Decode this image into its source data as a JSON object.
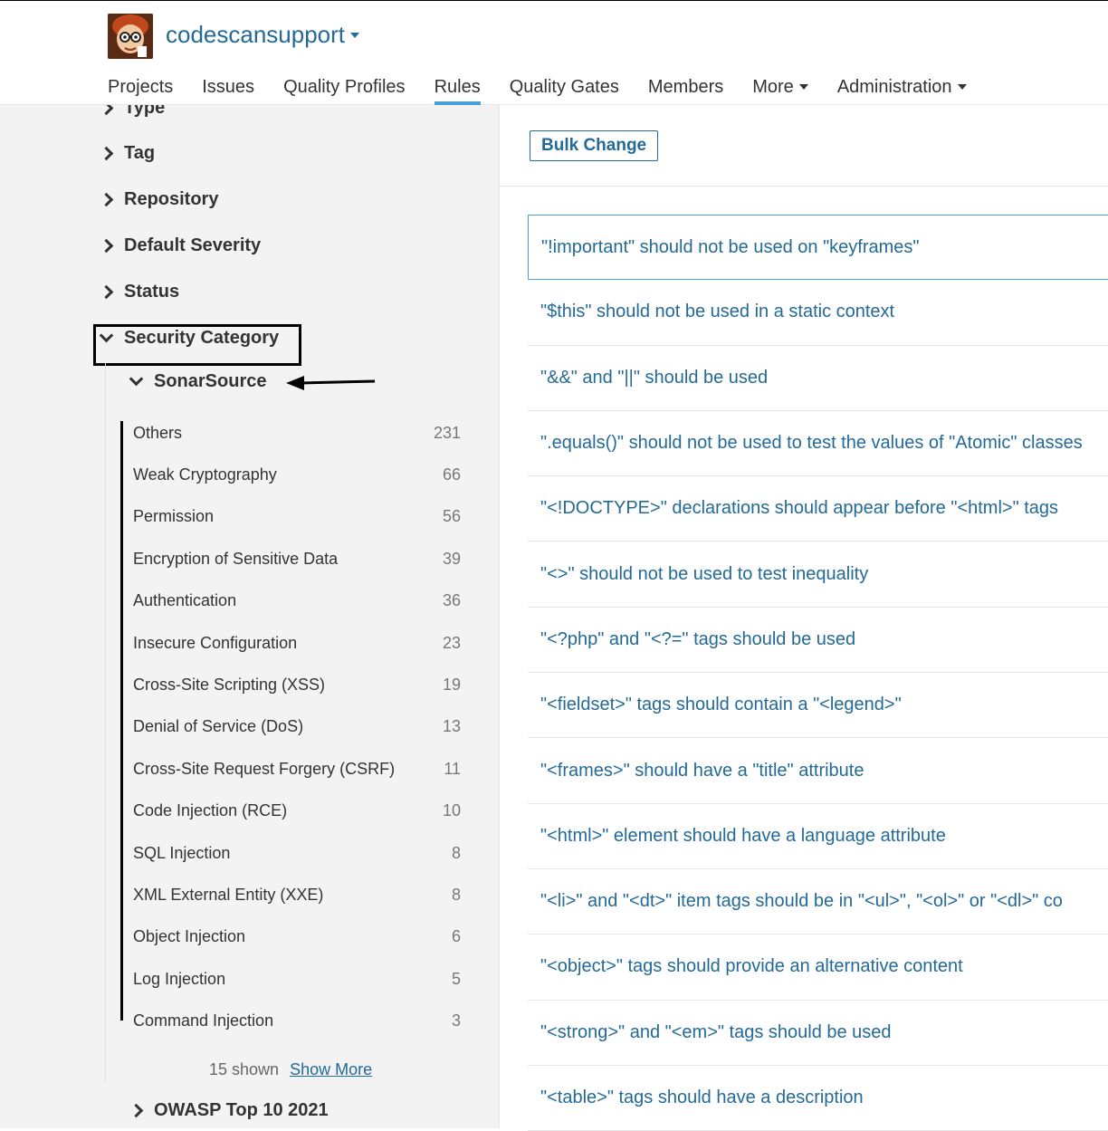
{
  "header": {
    "org_name": "codescansupport",
    "nav": [
      {
        "label": "Projects"
      },
      {
        "label": "Issues"
      },
      {
        "label": "Quality Profiles"
      },
      {
        "label": "Rules",
        "active": true
      },
      {
        "label": "Quality Gates"
      },
      {
        "label": "Members"
      },
      {
        "label": "More",
        "dropdown": true
      },
      {
        "label": "Administration",
        "dropdown": true
      }
    ]
  },
  "sidebar": {
    "facets": {
      "type": "Type",
      "tag": "Tag",
      "repository": "Repository",
      "severity": "Default Severity",
      "status": "Status",
      "security_category": "Security Category",
      "sonarsource": "SonarSource",
      "owasp": "OWASP Top 10 2021"
    },
    "categories": [
      {
        "name": "Others",
        "count": "231"
      },
      {
        "name": "Weak Cryptography",
        "count": "66"
      },
      {
        "name": "Permission",
        "count": "56"
      },
      {
        "name": "Encryption of Sensitive Data",
        "count": "39"
      },
      {
        "name": "Authentication",
        "count": "36"
      },
      {
        "name": "Insecure Configuration",
        "count": "23"
      },
      {
        "name": "Cross-Site Scripting (XSS)",
        "count": "19"
      },
      {
        "name": "Denial of Service (DoS)",
        "count": "13"
      },
      {
        "name": "Cross-Site Request Forgery (CSRF)",
        "count": "11"
      },
      {
        "name": "Code Injection (RCE)",
        "count": "10"
      },
      {
        "name": "SQL Injection",
        "count": "8"
      },
      {
        "name": "XML External Entity (XXE)",
        "count": "8"
      },
      {
        "name": "Object Injection",
        "count": "6"
      },
      {
        "name": "Log Injection",
        "count": "5"
      },
      {
        "name": "Command Injection",
        "count": "3"
      }
    ],
    "shown_text": "15 shown",
    "show_more": "Show More"
  },
  "main": {
    "bulk_change": "Bulk Change",
    "rules": [
      "\"!important\" should not be used on \"keyframes\"",
      "\"$this\" should not be used in a static context",
      "\"&&\" and \"||\" should be used",
      "\".equals()\" should not be used to test the values of \"Atomic\" classes",
      "\"<!DOCTYPE>\" declarations should appear before \"<html>\" tags",
      "\"<>\" should not be used to test inequality",
      "\"<?php\" and \"<?=\" tags should be used",
      "\"<fieldset>\" tags should contain a \"<legend>\"",
      "\"<frames>\" should have a \"title\" attribute",
      "\"<html>\" element should have a language attribute",
      "\"<li>\" and \"<dt>\" item tags should be in \"<ul>\", \"<ol>\" or \"<dl>\" co",
      "\"<object>\" tags should provide an alternative content",
      "\"<strong>\" and \"<em>\" tags should be used",
      "\"<table>\" tags should have a description"
    ]
  },
  "colors": {
    "link": "#236a97",
    "accent": "#4b9fd5",
    "sidebar_bg": "#f3f3f3"
  }
}
